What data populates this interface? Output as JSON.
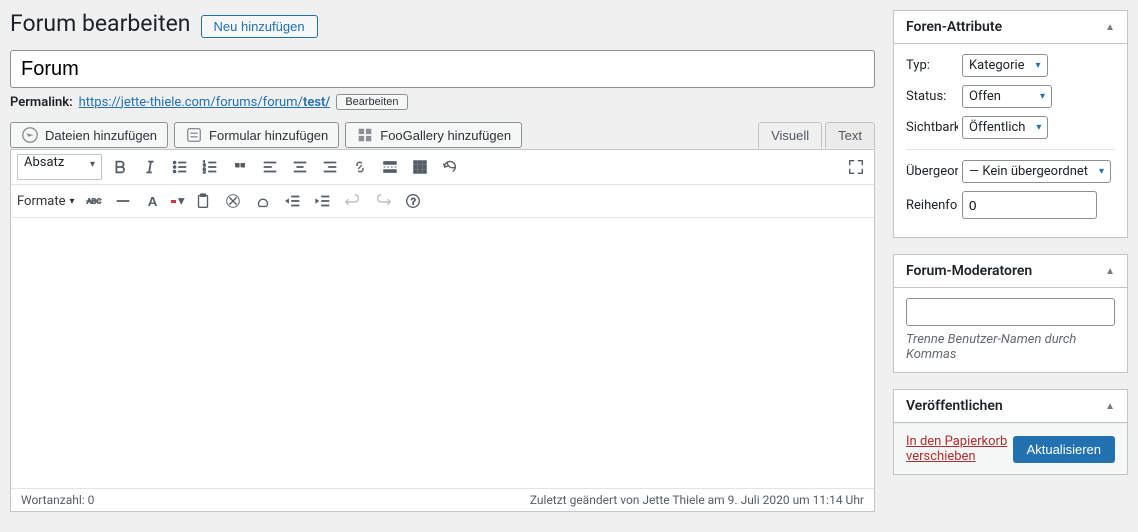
{
  "header": {
    "title": "Forum bearbeiten",
    "add_new": "Neu hinzufügen"
  },
  "post": {
    "title_value": "Forum",
    "permalink_label": "Permalink:",
    "permalink_base": "https://jette-thiele.com/forums/forum/",
    "permalink_slug": "test/",
    "edit_button": "Bearbeiten"
  },
  "media": {
    "files": "Dateien hinzufügen",
    "form": "Formular hinzufügen",
    "gallery": "FooGallery hinzufügen"
  },
  "tabs": {
    "visual": "Visuell",
    "text": "Text"
  },
  "toolbar": {
    "paragraph": "Absatz",
    "formats": "Formate"
  },
  "footer": {
    "wordcount_label": "Wortanzahl: ",
    "wordcount": "0",
    "last_edit": "Zuletzt geändert von Jette Thiele am 9. Juli 2020 um 11:14 Uhr"
  },
  "attrs": {
    "panel_title": "Foren-Attribute",
    "type_label": "Typ:",
    "type_value": "Kategorie",
    "status_label": "Status:",
    "status_value": "Offen",
    "visibility_label": "Sichtbarkeit",
    "visibility_value": "Öffentlich",
    "parent_label": "Übergeord",
    "parent_value": "— Kein übergeordnet",
    "order_label": "Reihenfolg",
    "order_value": "0"
  },
  "moderators": {
    "panel_title": "Forum-Moderatoren",
    "help": "Trenne Benutzer-Namen durch Kommas"
  },
  "publish": {
    "panel_title": "Veröffentlichen",
    "trash": "In den Papierkorb verschieben",
    "update": "Aktualisieren"
  }
}
